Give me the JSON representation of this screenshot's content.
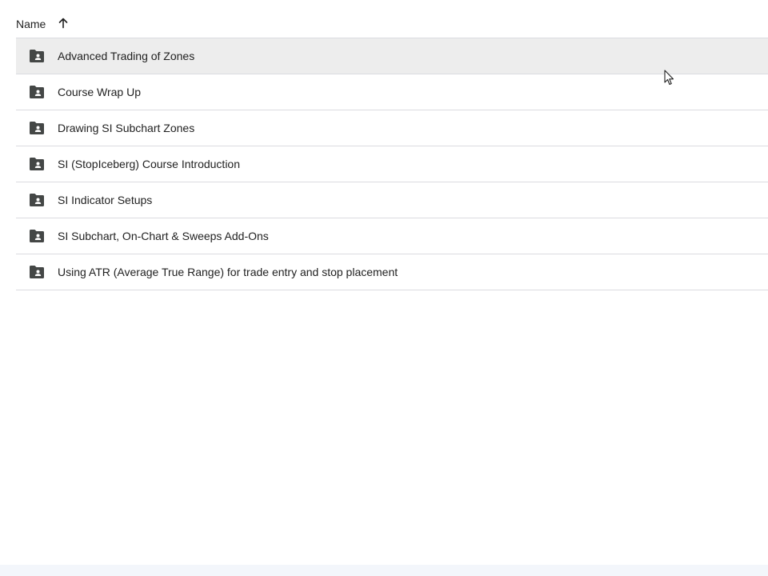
{
  "header": {
    "column_label": "Name",
    "sort_icon": "arrow-up-icon"
  },
  "folders": [
    {
      "label": "Advanced Trading of Zones",
      "icon": "shared-folder-icon"
    },
    {
      "label": "Course Wrap Up",
      "icon": "shared-folder-icon"
    },
    {
      "label": "Drawing SI Subchart Zones",
      "icon": "shared-folder-icon"
    },
    {
      "label": "SI (StopIceberg) Course Introduction",
      "icon": "shared-folder-icon"
    },
    {
      "label": "SI Indicator Setups",
      "icon": "shared-folder-icon"
    },
    {
      "label": "SI Subchart, On-Chart & Sweeps Add-Ons",
      "icon": "shared-folder-icon"
    },
    {
      "label": "Using ATR (Average True Range) for trade entry and stop placement",
      "icon": "shared-folder-icon"
    }
  ],
  "colors": {
    "divider": "#dadce0",
    "hover_row": "#ededed",
    "icon": "#444746"
  }
}
